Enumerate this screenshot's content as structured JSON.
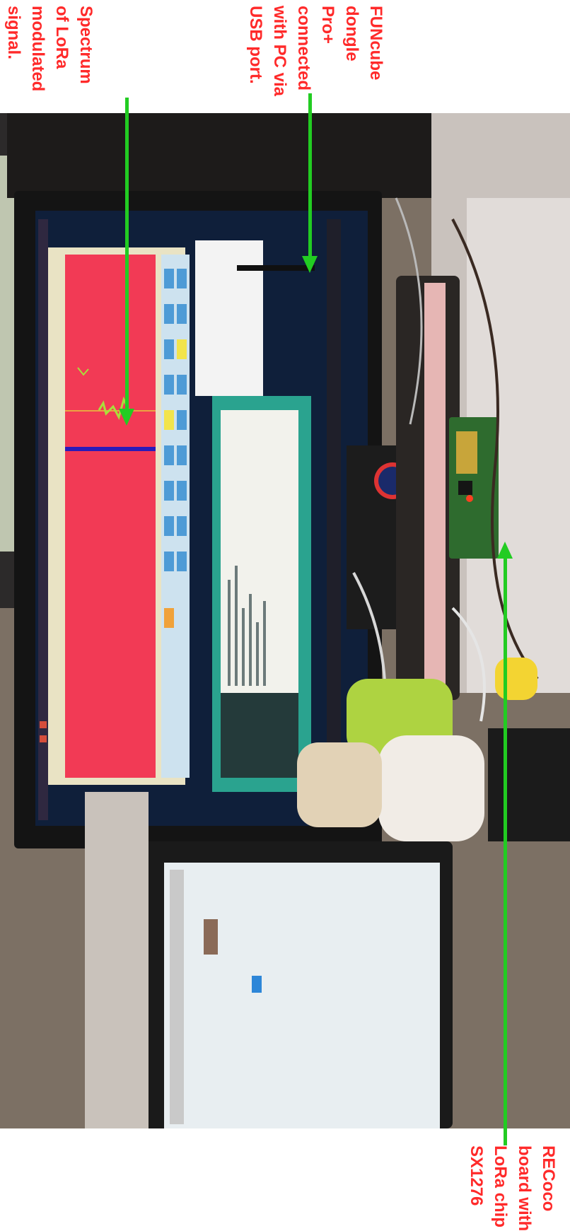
{
  "annotations": {
    "spectrum": {
      "lines": [
        "Spectrum",
        "of LoRa",
        "modulated",
        "signal."
      ]
    },
    "funcube": {
      "lines": [
        "FUNcube",
        "dongle",
        "Pro+",
        "connected",
        "with PC via",
        "USB port."
      ]
    },
    "recoco": {
      "lines": [
        "RECoco",
        "board with",
        "LoRa chip",
        "SX1276"
      ]
    }
  },
  "colors": {
    "annotation_text": "#ff2a2a",
    "arrow": "#22cc22",
    "spectrum_background": "#f23a55",
    "signal_line": "#2a1ab8"
  }
}
